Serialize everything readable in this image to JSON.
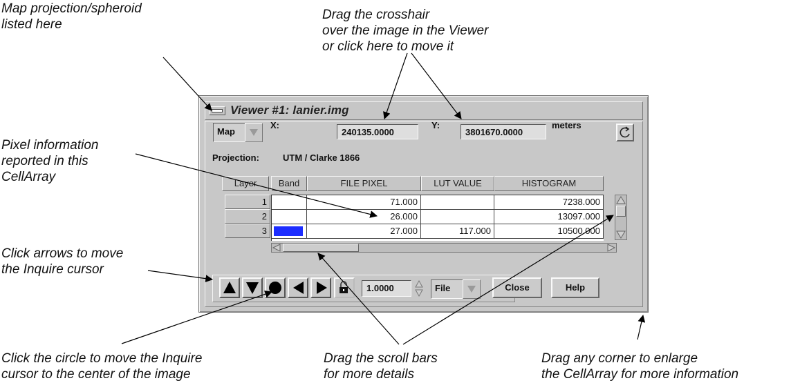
{
  "callouts": {
    "projection": "Map projection/spheroid\nlisted here",
    "crosshair": "Drag the crosshair\nover the image in the Viewer\nor click here to move it",
    "pixel_info": "Pixel information\nreported in this\nCellArray",
    "arrows": "Click arrows to move\nthe Inquire cursor",
    "circle": "Click the circle to move the Inquire\ncursor to the center of the image",
    "scroll": "Drag the scroll bars\nfor more details",
    "corner": "Drag any corner to enlarge\nthe CellArray for more information"
  },
  "window": {
    "title": "Viewer #1:  lanier.img",
    "coord_type": "Map",
    "x_label": "X:",
    "x_value": "240135.0000",
    "y_label": "Y:",
    "y_value": "3801670.0000",
    "units": "meters",
    "projection_label": "Projection:",
    "projection_value": "UTM / Clarke 1866",
    "increment": "1.0000",
    "mode": "File",
    "close_label": "Close",
    "help_label": "Help"
  },
  "table": {
    "headers": [
      "Layer",
      "Band",
      "FILE PIXEL",
      "LUT VALUE",
      "HISTOGRAM"
    ],
    "rows": [
      {
        "layer": "1",
        "band": "",
        "file_pixel": "71.000",
        "lut_value": "",
        "histogram": "7238.000"
      },
      {
        "layer": "2",
        "band": "",
        "file_pixel": "26.000",
        "lut_value": "",
        "histogram": "13097.000"
      },
      {
        "layer": "3",
        "band": "",
        "file_pixel": "27.000",
        "lut_value": "117.000",
        "histogram": "10500.000"
      }
    ]
  },
  "colors": {
    "band3_swatch": "#1c2dff",
    "window_bg": "#c8c8c8"
  },
  "icons": [
    "window-menu-icon",
    "refresh-icon",
    "up-arrow-icon",
    "down-arrow-icon",
    "center-circle-icon",
    "left-arrow-icon",
    "right-arrow-icon",
    "lock-icon"
  ]
}
